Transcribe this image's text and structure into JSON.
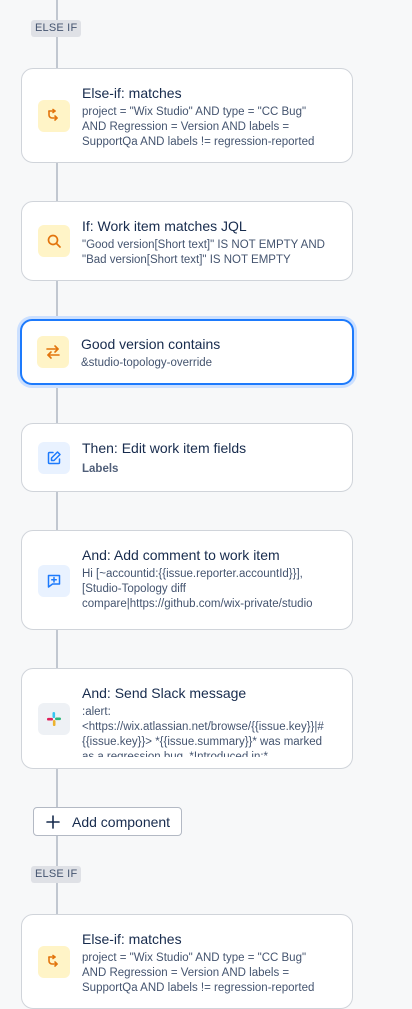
{
  "flow": {
    "else_if_label_1": "ELSE IF",
    "else_if_label_2": "ELSE IF",
    "add_component_label": "Add component",
    "components": [
      {
        "title": "Else-if: matches",
        "description": "project = \"Wix Studio\" AND type = \"CC Bug\" AND Regression = Version AND labels = SupportQa AND labels != regression-reported",
        "icon": "branch-icon"
      },
      {
        "title": "If: Work item matches JQL",
        "description": "\"Good version[Short text]\" IS NOT EMPTY AND \"Bad version[Short text]\" IS NOT EMPTY",
        "icon": "search-icon"
      },
      {
        "title": "Good version contains",
        "description": "&studio-topology-override",
        "icon": "swap-icon"
      },
      {
        "title": "Then: Edit work item fields",
        "description": "Labels",
        "icon": "edit-icon"
      },
      {
        "title": "And: Add comment to work item",
        "description": "Hi [~accountid:{{issue.reporter.accountId}}], [Studio-Topology diff compare|https://github.com/wix-private/studio",
        "icon": "comment-add-icon"
      },
      {
        "title": "And: Send Slack message",
        "description": ":alert: <https://wix.atlassian.net/browse/{{issue.key}}|#{{issue.key}}> *{{issue.summary}}* was marked as a regression bug. *Introduced in:*",
        "icon": "slack-icon"
      },
      {
        "title": "Else-if: matches",
        "description": "project = \"Wix Studio\" AND type = \"CC Bug\" AND Regression = Version AND labels = SupportQa AND labels != regression-reported",
        "icon": "branch-icon"
      }
    ]
  },
  "colors": {
    "accent": "#1d7afc",
    "condition_icon": "#e2740c",
    "action_icon": "#1d7afc"
  }
}
